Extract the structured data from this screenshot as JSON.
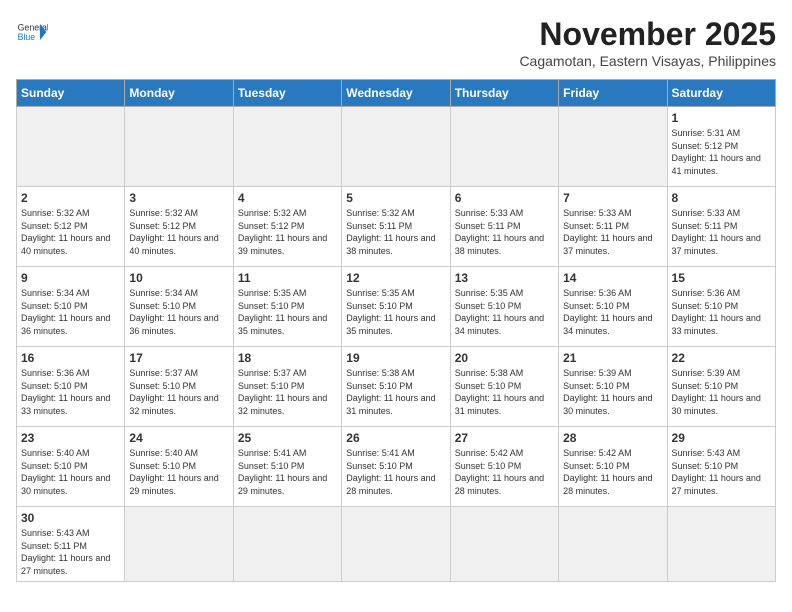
{
  "header": {
    "logo_general": "General",
    "logo_blue": "Blue",
    "month_year": "November 2025",
    "location": "Cagamotan, Eastern Visayas, Philippines"
  },
  "weekdays": [
    "Sunday",
    "Monday",
    "Tuesday",
    "Wednesday",
    "Thursday",
    "Friday",
    "Saturday"
  ],
  "weeks": [
    [
      {
        "day": "",
        "info": ""
      },
      {
        "day": "",
        "info": ""
      },
      {
        "day": "",
        "info": ""
      },
      {
        "day": "",
        "info": ""
      },
      {
        "day": "",
        "info": ""
      },
      {
        "day": "",
        "info": ""
      },
      {
        "day": "1",
        "info": "Sunrise: 5:31 AM\nSunset: 5:12 PM\nDaylight: 11 hours and 41 minutes."
      }
    ],
    [
      {
        "day": "2",
        "info": "Sunrise: 5:32 AM\nSunset: 5:12 PM\nDaylight: 11 hours and 40 minutes."
      },
      {
        "day": "3",
        "info": "Sunrise: 5:32 AM\nSunset: 5:12 PM\nDaylight: 11 hours and 40 minutes."
      },
      {
        "day": "4",
        "info": "Sunrise: 5:32 AM\nSunset: 5:12 PM\nDaylight: 11 hours and 39 minutes."
      },
      {
        "day": "5",
        "info": "Sunrise: 5:32 AM\nSunset: 5:11 PM\nDaylight: 11 hours and 38 minutes."
      },
      {
        "day": "6",
        "info": "Sunrise: 5:33 AM\nSunset: 5:11 PM\nDaylight: 11 hours and 38 minutes."
      },
      {
        "day": "7",
        "info": "Sunrise: 5:33 AM\nSunset: 5:11 PM\nDaylight: 11 hours and 37 minutes."
      },
      {
        "day": "8",
        "info": "Sunrise: 5:33 AM\nSunset: 5:11 PM\nDaylight: 11 hours and 37 minutes."
      }
    ],
    [
      {
        "day": "9",
        "info": "Sunrise: 5:34 AM\nSunset: 5:10 PM\nDaylight: 11 hours and 36 minutes."
      },
      {
        "day": "10",
        "info": "Sunrise: 5:34 AM\nSunset: 5:10 PM\nDaylight: 11 hours and 36 minutes."
      },
      {
        "day": "11",
        "info": "Sunrise: 5:35 AM\nSunset: 5:10 PM\nDaylight: 11 hours and 35 minutes."
      },
      {
        "day": "12",
        "info": "Sunrise: 5:35 AM\nSunset: 5:10 PM\nDaylight: 11 hours and 35 minutes."
      },
      {
        "day": "13",
        "info": "Sunrise: 5:35 AM\nSunset: 5:10 PM\nDaylight: 11 hours and 34 minutes."
      },
      {
        "day": "14",
        "info": "Sunrise: 5:36 AM\nSunset: 5:10 PM\nDaylight: 11 hours and 34 minutes."
      },
      {
        "day": "15",
        "info": "Sunrise: 5:36 AM\nSunset: 5:10 PM\nDaylight: 11 hours and 33 minutes."
      }
    ],
    [
      {
        "day": "16",
        "info": "Sunrise: 5:36 AM\nSunset: 5:10 PM\nDaylight: 11 hours and 33 minutes."
      },
      {
        "day": "17",
        "info": "Sunrise: 5:37 AM\nSunset: 5:10 PM\nDaylight: 11 hours and 32 minutes."
      },
      {
        "day": "18",
        "info": "Sunrise: 5:37 AM\nSunset: 5:10 PM\nDaylight: 11 hours and 32 minutes."
      },
      {
        "day": "19",
        "info": "Sunrise: 5:38 AM\nSunset: 5:10 PM\nDaylight: 11 hours and 31 minutes."
      },
      {
        "day": "20",
        "info": "Sunrise: 5:38 AM\nSunset: 5:10 PM\nDaylight: 11 hours and 31 minutes."
      },
      {
        "day": "21",
        "info": "Sunrise: 5:39 AM\nSunset: 5:10 PM\nDaylight: 11 hours and 30 minutes."
      },
      {
        "day": "22",
        "info": "Sunrise: 5:39 AM\nSunset: 5:10 PM\nDaylight: 11 hours and 30 minutes."
      }
    ],
    [
      {
        "day": "23",
        "info": "Sunrise: 5:40 AM\nSunset: 5:10 PM\nDaylight: 11 hours and 30 minutes."
      },
      {
        "day": "24",
        "info": "Sunrise: 5:40 AM\nSunset: 5:10 PM\nDaylight: 11 hours and 29 minutes."
      },
      {
        "day": "25",
        "info": "Sunrise: 5:41 AM\nSunset: 5:10 PM\nDaylight: 11 hours and 29 minutes."
      },
      {
        "day": "26",
        "info": "Sunrise: 5:41 AM\nSunset: 5:10 PM\nDaylight: 11 hours and 28 minutes."
      },
      {
        "day": "27",
        "info": "Sunrise: 5:42 AM\nSunset: 5:10 PM\nDaylight: 11 hours and 28 minutes."
      },
      {
        "day": "28",
        "info": "Sunrise: 5:42 AM\nSunset: 5:10 PM\nDaylight: 11 hours and 28 minutes."
      },
      {
        "day": "29",
        "info": "Sunrise: 5:43 AM\nSunset: 5:10 PM\nDaylight: 11 hours and 27 minutes."
      }
    ],
    [
      {
        "day": "30",
        "info": "Sunrise: 5:43 AM\nSunset: 5:11 PM\nDaylight: 11 hours and 27 minutes."
      },
      {
        "day": "",
        "info": ""
      },
      {
        "day": "",
        "info": ""
      },
      {
        "day": "",
        "info": ""
      },
      {
        "day": "",
        "info": ""
      },
      {
        "day": "",
        "info": ""
      },
      {
        "day": "",
        "info": ""
      }
    ]
  ]
}
